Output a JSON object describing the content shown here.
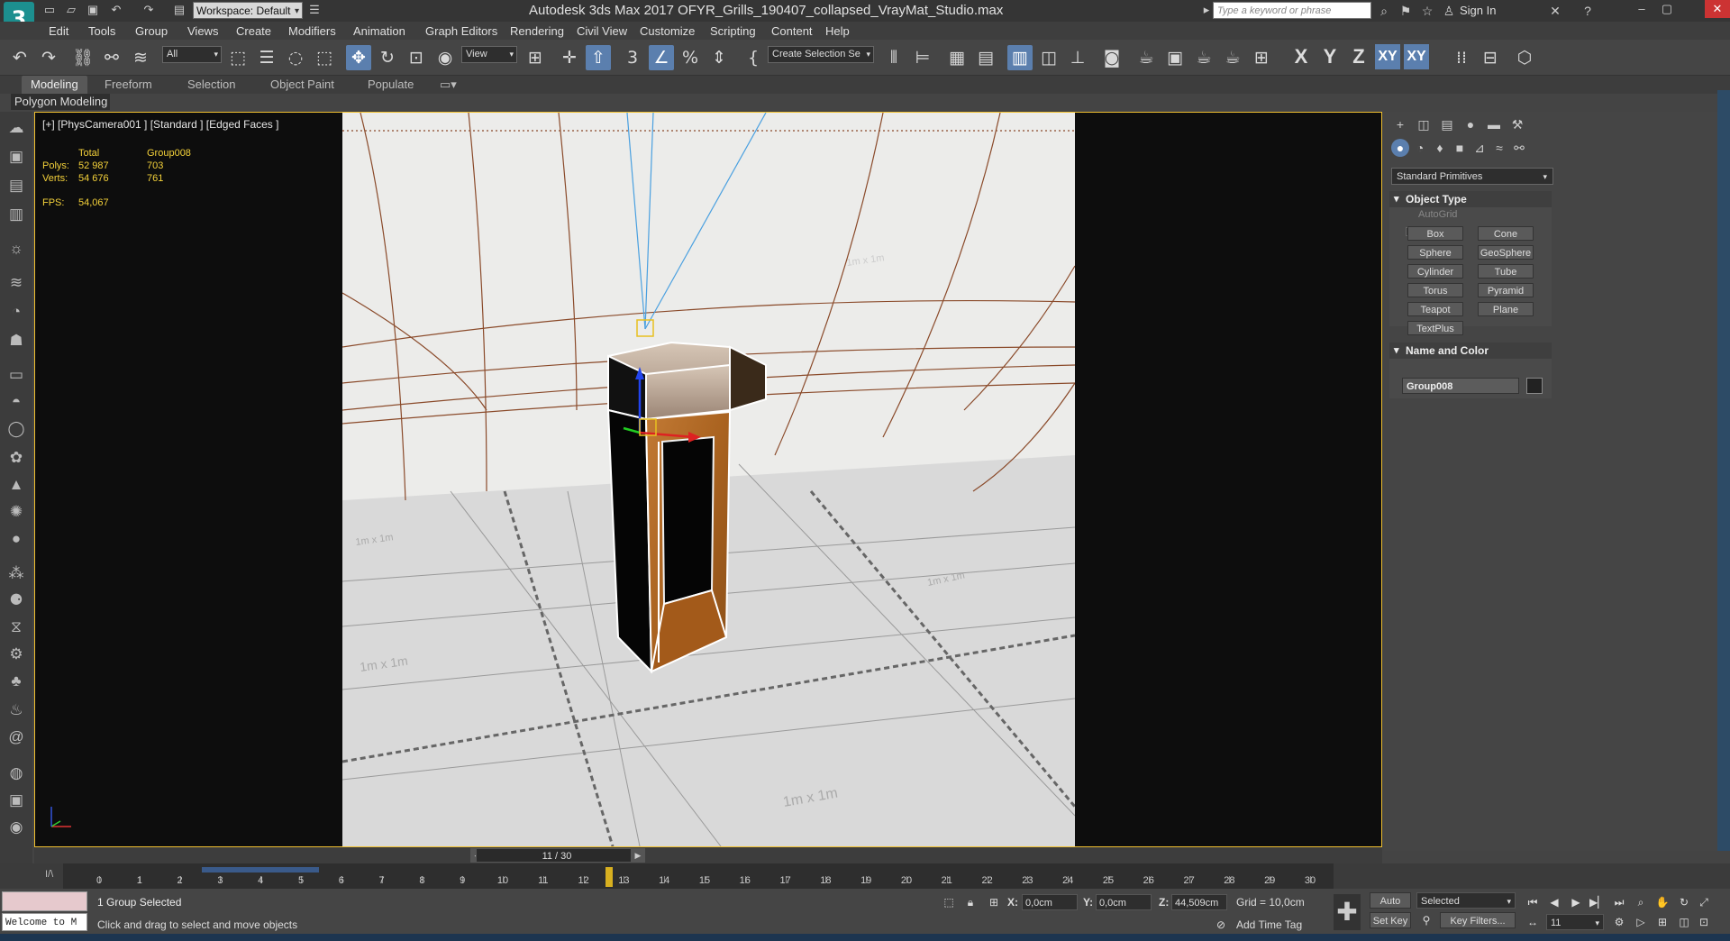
{
  "title": {
    "logo_text": "3",
    "workspace": "Workspace: Default",
    "window_title": "Autodesk 3ds Max 2017     OFYR_Grills_190407_collapsed_VrayMat_Studio.max",
    "search_placeholder": "Type a keyword or phrase",
    "sign_in": "Sign In"
  },
  "menu": [
    "Edit",
    "Tools",
    "Group",
    "Views",
    "Create",
    "Modifiers",
    "Animation",
    "Graph Editors",
    "Rendering",
    "Civil View",
    "Customize",
    "Scripting",
    "Content",
    "Help"
  ],
  "toolbar": {
    "selection_filter": "All",
    "ref_coord": "View",
    "named_selection": "Create Selection Se",
    "axis_x": "X",
    "axis_y": "Y",
    "axis_z": "Z",
    "axis_xy": "XY",
    "axis_xy2": "XY"
  },
  "ribbon": {
    "tabs": [
      "Modeling",
      "Freeform",
      "Selection",
      "Object Paint",
      "Populate"
    ],
    "sub": "Polygon Modeling"
  },
  "viewport": {
    "label": "[+] [PhysCamera001 ] [Standard ] [Edged Faces ]",
    "stats": {
      "total_header": "Total",
      "group_header": "Group008",
      "polys_label": "Polys:",
      "polys_total": "52 987",
      "polys_group": "703",
      "verts_label": "Verts:",
      "verts_total": "54 676",
      "verts_group": "761",
      "fps_label": "FPS:",
      "fps_value": "54,067"
    },
    "grid_labels": [
      "1m x 1m",
      "1m x 1m",
      "1m x 1m",
      "1m x 1m",
      "1m x 1m"
    ]
  },
  "command_panel": {
    "category": "Standard Primitives",
    "object_type_header": "Object Type",
    "autogrid": "AutoGrid",
    "buttons": [
      "Box",
      "Cone",
      "Sphere",
      "GeoSphere",
      "Cylinder",
      "Tube",
      "Torus",
      "Pyramid",
      "Teapot",
      "Plane",
      "TextPlus"
    ],
    "name_color_header": "Name and Color",
    "object_name": "Group008"
  },
  "timeline": {
    "frame_display": "11 / 30",
    "ticks": [
      "0",
      "1",
      "2",
      "3",
      "4",
      "5",
      "6",
      "7",
      "8",
      "9",
      "10",
      "11",
      "12",
      "13",
      "14",
      "15",
      "16",
      "17",
      "18",
      "19",
      "20",
      "21",
      "22",
      "23",
      "24",
      "25",
      "26",
      "27",
      "28",
      "29",
      "30"
    ]
  },
  "status": {
    "welcome": "Welcome to M",
    "selection": "1 Group Selected",
    "prompt": "Click and drag to select and move objects",
    "x_label": "X:",
    "x_value": "0,0cm",
    "y_label": "Y:",
    "y_value": "0,0cm",
    "z_label": "Z:",
    "z_value": "44,509cm",
    "grid": "Grid = 10,0cm",
    "add_time_tag": "Add Time Tag",
    "auto_key": "Auto Key",
    "set_key": "Set Key",
    "selected_dd": "Selected",
    "key_filters": "Key Filters...",
    "frame_field": "11"
  }
}
